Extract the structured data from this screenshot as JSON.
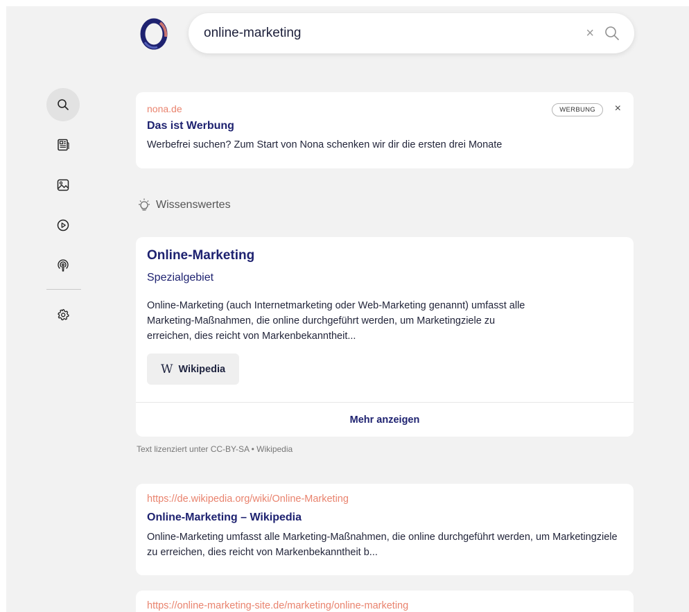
{
  "search": {
    "value": "online-marketing",
    "clear_label": "×"
  },
  "sidebar": {
    "items": [
      {
        "name": "search",
        "icon": "search-icon",
        "active": true
      },
      {
        "name": "news",
        "icon": "news-icon"
      },
      {
        "name": "images",
        "icon": "image-icon"
      },
      {
        "name": "videos",
        "icon": "play-icon"
      },
      {
        "name": "podcasts",
        "icon": "podcast-icon"
      },
      {
        "name": "settings",
        "icon": "gear-icon"
      }
    ]
  },
  "ad": {
    "domain": "nona.de",
    "title": "Das ist Werbung",
    "description": "Werbefrei suchen? Zum Start von Nona schenken wir dir die ersten drei Monate",
    "badge": "WERBUNG",
    "close_label": "×"
  },
  "knowledge_section": {
    "label": "Wissenswertes"
  },
  "knowledge_panel": {
    "title": "Online-Marketing",
    "subtitle": "Spezialgebiet",
    "description": "Online-Marketing (auch Internetmarketing oder Web-Marketing genannt) umfasst alle Marketing-Maßnahmen, die online durchgeführt werden, um Marketingziele zu erreichen, dies reicht von Markenbekanntheit...",
    "source_button": {
      "glyph": "W",
      "label": "Wikipedia"
    },
    "more_label": "Mehr anzeigen"
  },
  "license": "Text lizenziert unter CC-BY-SA  •  Wikipedia",
  "results": [
    {
      "url": "https://de.wikipedia.org/wiki/Online-Marketing",
      "title": "Online-Marketing – Wikipedia",
      "description": "Online-Marketing umfasst alle Marketing-Maßnahmen, die online durchgeführt werden, um Marketingziele zu erreichen, dies reicht von Markenbekanntheit b..."
    },
    {
      "url": "https://online-marketing-site.de/marketing/online-marketing"
    }
  ],
  "colors": {
    "accent_link": "#e9836e",
    "title_navy": "#1e2270",
    "background": "#f2f2f2"
  }
}
